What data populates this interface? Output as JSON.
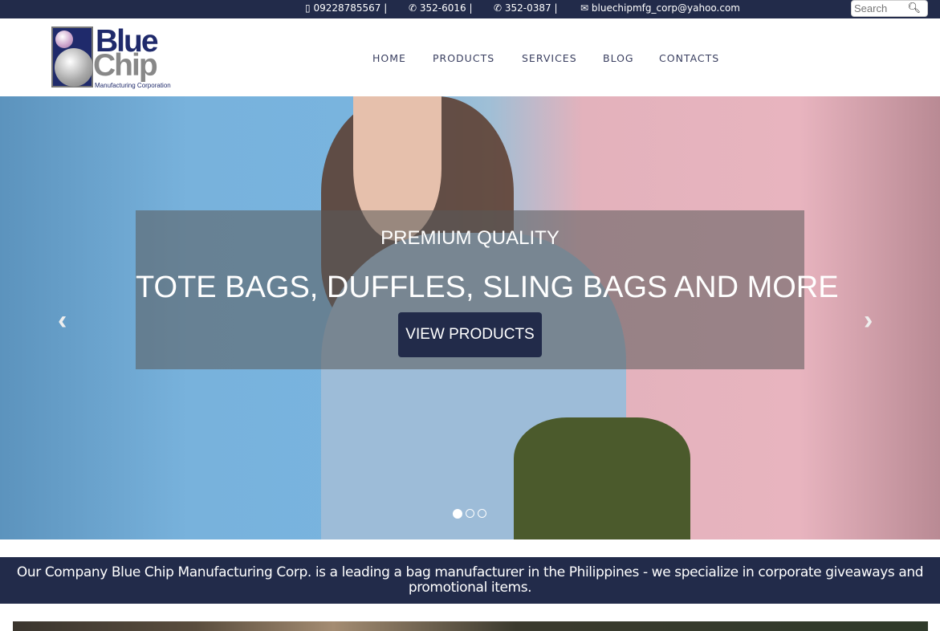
{
  "topbar": {
    "mobile": "09228785567 |",
    "phone1": "352-6016 |",
    "phone2": "352-0387 |",
    "email": "bluechipmfg_corp@yahoo.com",
    "search_placeholder": "Search"
  },
  "logo": {
    "line1": "Blue",
    "line2": "Chip",
    "line3": "Manufacturing Corporation"
  },
  "nav": {
    "items": [
      "HOME",
      "PRODUCTS",
      "SERVICES",
      "BLOG",
      "CONTACTS"
    ]
  },
  "hero": {
    "subtitle": "PREMIUM QUALITY",
    "title": "TOTE BAGS, DUFFLES, SLING BAGS AND MORE",
    "button": "VIEW PRODUCTS",
    "prev": "‹",
    "next": "›",
    "active_slide": 1,
    "slide_count": 3
  },
  "banner": {
    "text": "Our Company Blue Chip Manufacturing Corp. is a leading a bag manufacturer in the Philippines - we specialize in corporate giveaways and promotional items."
  },
  "colors": {
    "brand": "#222b4a"
  }
}
